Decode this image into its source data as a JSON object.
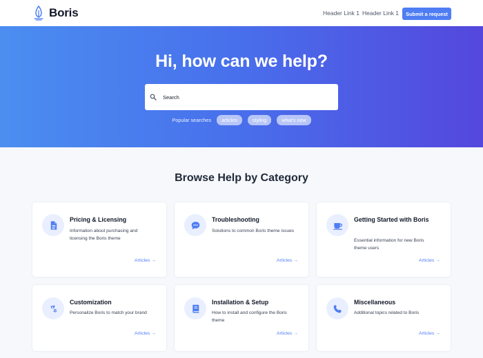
{
  "header": {
    "logo_text": "Boris",
    "nav_links": [
      "Header Link 1",
      "Header Link 1"
    ],
    "submit_label": "Submit a request",
    "accent_color": "#4f7df3"
  },
  "hero": {
    "title": "Hi, how can we help?",
    "search": {
      "placeholder": "Search",
      "value": ""
    },
    "popular_label": "Popular searches",
    "popular_searches": [
      "articles",
      "styling",
      "what's now"
    ]
  },
  "categories": {
    "title": "Browse Help by Category",
    "items": [
      {
        "title": "Pricing & Licensing",
        "description": "Information about purchasing and licensing the Boris theme",
        "link_label": "Articles",
        "icon": "document-icon"
      },
      {
        "title": "Troubleshooting",
        "description": "Solutions to common Boris theme issues",
        "link_label": "Articles",
        "icon": "chat-bubble-icon"
      },
      {
        "title": "Getting Started with Boris",
        "description": "Essential information for new Boris theme users",
        "link_label": "Articles",
        "icon": "coffee-cup-icon"
      },
      {
        "title": "Customization",
        "description": "Personalize Boris to match your brand",
        "link_label": "Articles",
        "icon": "gears-icon"
      },
      {
        "title": "Installation & Setup",
        "description": "How to install and configure the Boris theme",
        "link_label": "Articles",
        "icon": "book-icon"
      },
      {
        "title": "Miscellaneous",
        "description": "Additional topics related to Boris",
        "link_label": "Articles",
        "icon": "phone-icon"
      }
    ]
  }
}
